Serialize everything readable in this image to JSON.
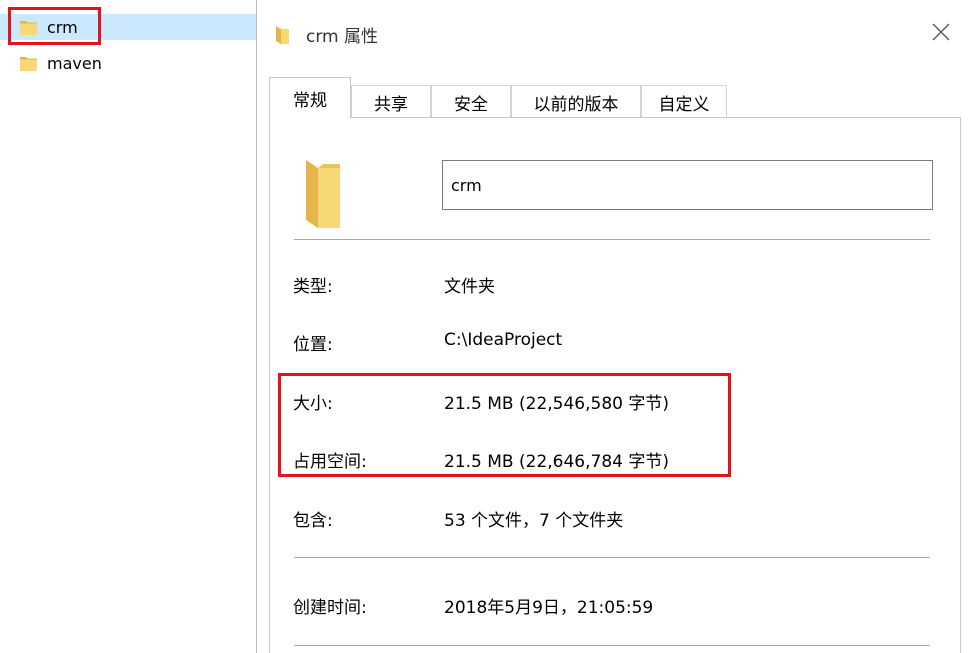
{
  "explorer": {
    "items": [
      {
        "label": "crm",
        "selected": true
      },
      {
        "label": "maven",
        "selected": false
      }
    ]
  },
  "dialog": {
    "title": "crm 属性",
    "tabs": [
      {
        "label": "常规",
        "active": true
      },
      {
        "label": "共享",
        "active": false
      },
      {
        "label": "安全",
        "active": false
      },
      {
        "label": "以前的版本",
        "active": false
      },
      {
        "label": "自定义",
        "active": false
      }
    ],
    "name_value": "crm",
    "properties": {
      "type_label": "类型:",
      "type_value": "文件夹",
      "location_label": "位置:",
      "location_value": "C:\\IdeaProject",
      "size_label": "大小:",
      "size_value": "21.5 MB (22,546,580 字节)",
      "disk_label": "占用空间:",
      "disk_value": "21.5 MB (22,646,784 字节)",
      "contains_label": "包含:",
      "contains_value": "53 个文件，7 个文件夹",
      "created_label": "创建时间:",
      "created_value": "2018年5月9日，21:05:59"
    }
  },
  "colors": {
    "highlight": "#e3121c",
    "selection": "#cce8ff",
    "folder_front": "#f8d775",
    "folder_back": "#e4b548"
  }
}
